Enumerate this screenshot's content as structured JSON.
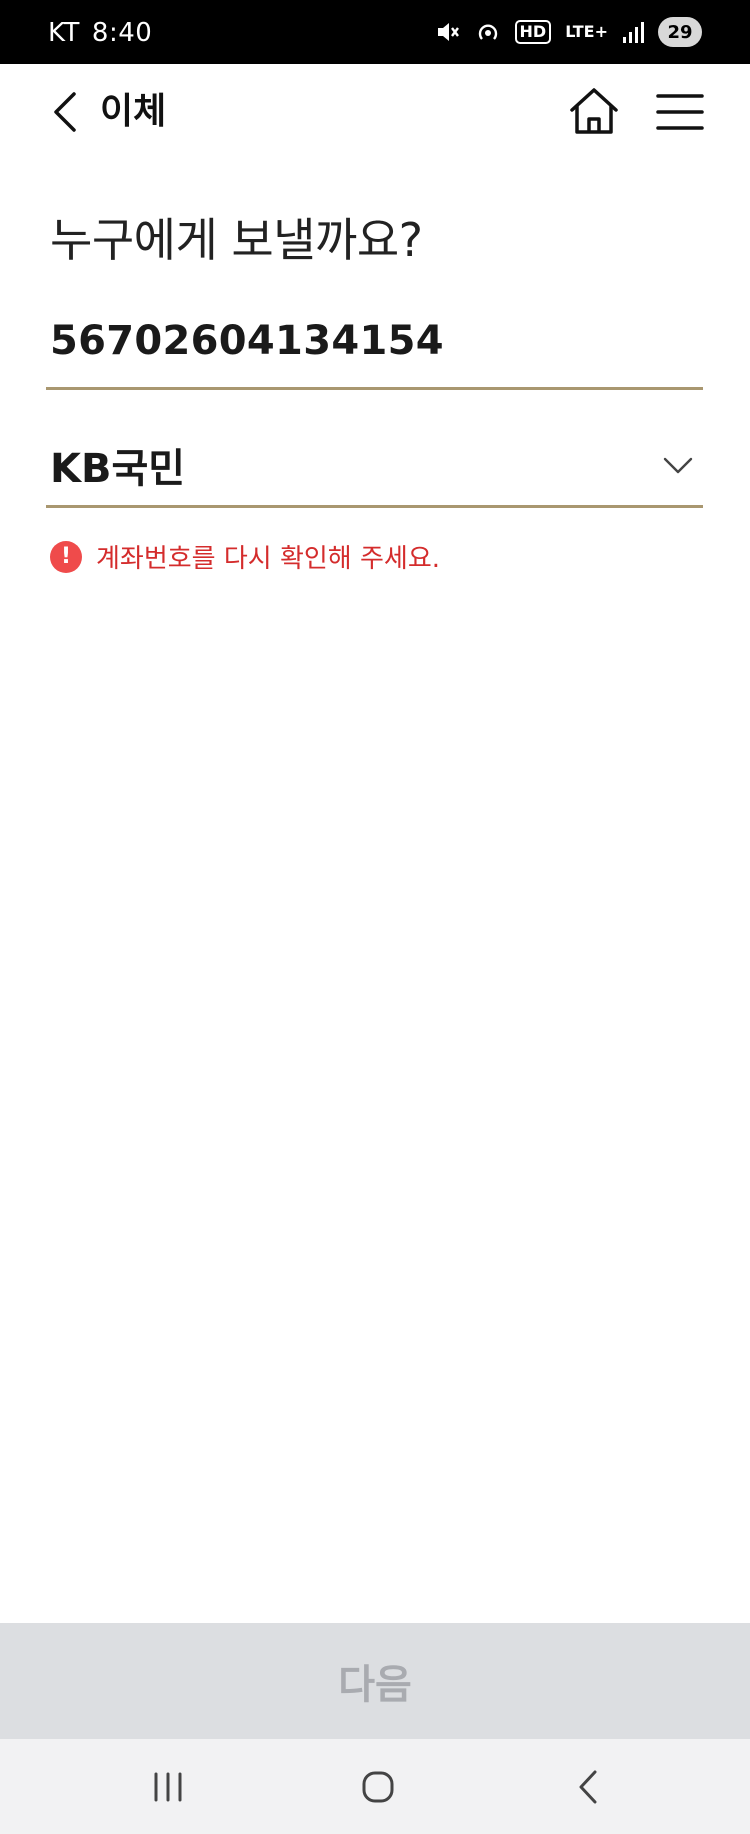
{
  "status_bar": {
    "carrier": "KT",
    "time": "8:40",
    "hd_label": "HD",
    "network_label": "LTE+",
    "battery": "29"
  },
  "header": {
    "title": "이체"
  },
  "transfer": {
    "question": "누구에게 보낼까요?",
    "account_number": "56702604134154",
    "bank": "KB국민",
    "error_message": "계좌번호를 다시 확인해 주세요."
  },
  "footer": {
    "next_label": "다음"
  },
  "colors": {
    "underline": "#a99770",
    "error": "#d42c2c",
    "error_icon": "#ef4b4b",
    "button_disabled": "#dcdee1"
  }
}
